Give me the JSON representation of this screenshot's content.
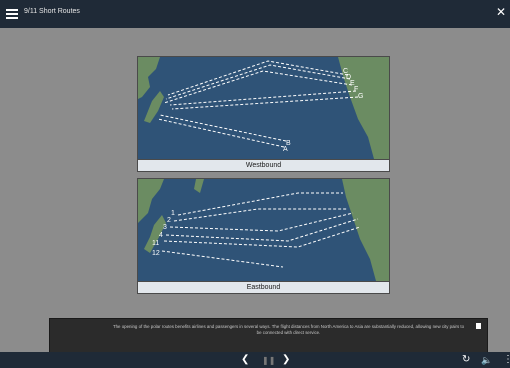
{
  "app": {
    "title": "9/11 Short Routes"
  },
  "westbound": {
    "caption": "Westbound",
    "route_labels": [
      "C",
      "D",
      "E",
      "F",
      "G",
      "B",
      "A"
    ]
  },
  "eastbound": {
    "caption": "Eastbound",
    "route_labels": [
      "1",
      "2",
      "3",
      "4",
      "11",
      "12"
    ]
  },
  "narration": {
    "text": "The opening of the polar routes benefits airlines and passengers in several ways. The flight distances from North America to Asia are substantially reduced, allowing new city pairs to be connected with direct service."
  },
  "colors": {
    "ocean": "#2f5377",
    "land": "#6b8c62",
    "route": "#ffffff",
    "chrome": "#1f2a37"
  },
  "icons": [
    "menu-icon",
    "close-icon",
    "back-icon",
    "pause-icon",
    "forward-icon",
    "replay-icon",
    "volume-icon",
    "more-icon",
    "transcript-icon"
  ]
}
